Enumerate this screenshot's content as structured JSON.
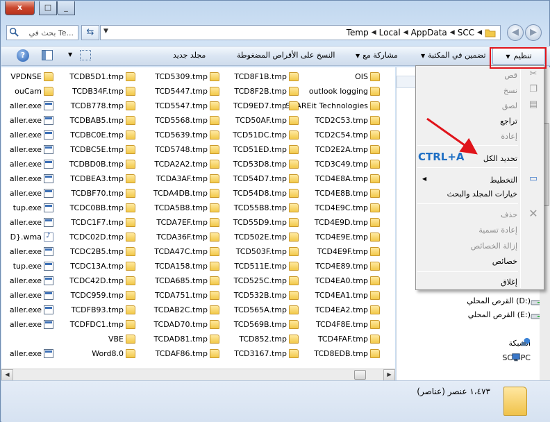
{
  "window": {
    "close_glyph": "x",
    "max_glyph": "□",
    "min_glyph": "_"
  },
  "address": {
    "search_placeholder": "بحث في Te...",
    "crumbs": [
      "SCC",
      "AppData",
      "Local",
      "Temp"
    ]
  },
  "toolbar": {
    "organize": "تنظيم",
    "include_library": "تضمين في المكتبة",
    "share_with": "مشاركة مع",
    "burn": "النسخ على الأقراص المضغوطة",
    "new_folder": "مجلد جديد"
  },
  "file_columns": [
    [
      {
        "name": "OIS",
        "icon": "folder"
      },
      {
        "name": "outlook logging",
        "icon": "folder"
      },
      {
        "name": "SHAREit Technologies",
        "icon": "folder"
      },
      {
        "name": "TCD2C53.tmp",
        "icon": "folder"
      },
      {
        "name": "TCD2C54.tmp",
        "icon": "folder"
      },
      {
        "name": "TCD2E2A.tmp",
        "icon": "folder"
      },
      {
        "name": "TCD3C49.tmp",
        "icon": "folder"
      },
      {
        "name": "TCD4E8A.tmp",
        "icon": "folder"
      },
      {
        "name": "TCD4E8B.tmp",
        "icon": "folder"
      },
      {
        "name": "TCD4E9C.tmp",
        "icon": "folder"
      },
      {
        "name": "TCD4E9D.tmp",
        "icon": "folder"
      },
      {
        "name": "TCD4E9E.tmp",
        "icon": "folder"
      },
      {
        "name": "TCD4E9F.tmp",
        "icon": "folder"
      },
      {
        "name": "TCD4E89.tmp",
        "icon": "folder"
      },
      {
        "name": "TCD4EA0.tmp",
        "icon": "folder"
      },
      {
        "name": "TCD4EA1.tmp",
        "icon": "folder"
      },
      {
        "name": "TCD4EA2.tmp",
        "icon": "folder"
      },
      {
        "name": "TCD4F8E.tmp",
        "icon": "folder"
      },
      {
        "name": "TCD4FAF.tmp",
        "icon": "folder"
      },
      {
        "name": "TCD8EDB.tmp",
        "icon": "folder"
      }
    ],
    [
      {
        "name": "TCD8F1B.tmp",
        "icon": "folder"
      },
      {
        "name": "TCD8F2B.tmp",
        "icon": "folder"
      },
      {
        "name": "TCD9ED7.tmp",
        "icon": "folder"
      },
      {
        "name": "TCD50AF.tmp",
        "icon": "folder"
      },
      {
        "name": "TCD51DC.tmp",
        "icon": "folder"
      },
      {
        "name": "TCD51ED.tmp",
        "icon": "folder"
      },
      {
        "name": "TCD53D8.tmp",
        "icon": "folder"
      },
      {
        "name": "TCD54D7.tmp",
        "icon": "folder"
      },
      {
        "name": "TCD54D8.tmp",
        "icon": "folder"
      },
      {
        "name": "TCD55B8.tmp",
        "icon": "folder"
      },
      {
        "name": "TCD55D9.tmp",
        "icon": "folder"
      },
      {
        "name": "TCD502E.tmp",
        "icon": "folder"
      },
      {
        "name": "TCD503F.tmp",
        "icon": "folder"
      },
      {
        "name": "TCD511E.tmp",
        "icon": "folder"
      },
      {
        "name": "TCD525C.tmp",
        "icon": "folder"
      },
      {
        "name": "TCD532B.tmp",
        "icon": "folder"
      },
      {
        "name": "TCD565A.tmp",
        "icon": "folder"
      },
      {
        "name": "TCD569B.tmp",
        "icon": "folder"
      },
      {
        "name": "TCD852.tmp",
        "icon": "folder"
      },
      {
        "name": "TCD3167.tmp",
        "icon": "folder"
      }
    ],
    [
      {
        "name": "TCD5309.tmp",
        "icon": "folder"
      },
      {
        "name": "TCD5447.tmp",
        "icon": "folder"
      },
      {
        "name": "TCD5547.tmp",
        "icon": "folder"
      },
      {
        "name": "TCD5568.tmp",
        "icon": "folder"
      },
      {
        "name": "TCD5639.tmp",
        "icon": "folder"
      },
      {
        "name": "TCD5748.tmp",
        "icon": "folder"
      },
      {
        "name": "TCDA2A2.tmp",
        "icon": "folder"
      },
      {
        "name": "TCDA3AF.tmp",
        "icon": "folder"
      },
      {
        "name": "TCDA4DB.tmp",
        "icon": "folder"
      },
      {
        "name": "TCDA5B8.tmp",
        "icon": "folder"
      },
      {
        "name": "TCDA7EF.tmp",
        "icon": "folder"
      },
      {
        "name": "TCDA36F.tmp",
        "icon": "folder"
      },
      {
        "name": "TCDA47C.tmp",
        "icon": "folder"
      },
      {
        "name": "TCDA158.tmp",
        "icon": "folder"
      },
      {
        "name": "TCDA685.tmp",
        "icon": "folder"
      },
      {
        "name": "TCDA751.tmp",
        "icon": "folder"
      },
      {
        "name": "TCDAB2C.tmp",
        "icon": "folder"
      },
      {
        "name": "TCDAD70.tmp",
        "icon": "folder"
      },
      {
        "name": "TCDAD81.tmp",
        "icon": "folder"
      },
      {
        "name": "TCDAF86.tmp",
        "icon": "folder"
      }
    ],
    [
      {
        "name": "TCDB5D1.tmp",
        "icon": "folder"
      },
      {
        "name": "TCDB34F.tmp",
        "icon": "folder"
      },
      {
        "name": "TCDB778.tmp",
        "icon": "folder"
      },
      {
        "name": "TCDBAB5.tmp",
        "icon": "folder"
      },
      {
        "name": "TCDBC0E.tmp",
        "icon": "folder"
      },
      {
        "name": "TCDBC5E.tmp",
        "icon": "folder"
      },
      {
        "name": "TCDBD0B.tmp",
        "icon": "folder"
      },
      {
        "name": "TCDBEA3.tmp",
        "icon": "folder"
      },
      {
        "name": "TCDBF70.tmp",
        "icon": "folder"
      },
      {
        "name": "TCDC0BB.tmp",
        "icon": "folder"
      },
      {
        "name": "TCDC1F7.tmp",
        "icon": "folder"
      },
      {
        "name": "TCDC02D.tmp",
        "icon": "folder"
      },
      {
        "name": "TCDC2B5.tmp",
        "icon": "folder"
      },
      {
        "name": "TCDC13A.tmp",
        "icon": "folder"
      },
      {
        "name": "TCDC42D.tmp",
        "icon": "folder"
      },
      {
        "name": "TCDC959.tmp",
        "icon": "folder"
      },
      {
        "name": "TCDFB93.tmp",
        "icon": "folder"
      },
      {
        "name": "TCDFDC1.tmp",
        "icon": "folder"
      },
      {
        "name": "VBE",
        "icon": "folder"
      },
      {
        "name": "Word8.0",
        "icon": "folder"
      }
    ],
    [
      {
        "name": "VPDNSE",
        "icon": "folder"
      },
      {
        "name": "ouCam",
        "icon": "folder"
      },
      {
        "name": "aller.exe",
        "icon": "exe"
      },
      {
        "name": "aller.exe",
        "icon": "exe"
      },
      {
        "name": "aller.exe",
        "icon": "exe"
      },
      {
        "name": "aller.exe",
        "icon": "exe"
      },
      {
        "name": "aller.exe",
        "icon": "exe"
      },
      {
        "name": "aller.exe",
        "icon": "exe"
      },
      {
        "name": "aller.exe",
        "icon": "exe"
      },
      {
        "name": "tup.exe",
        "icon": "exe"
      },
      {
        "name": "aller.exe",
        "icon": "exe"
      },
      {
        "name": "D}.wma",
        "icon": "wma"
      },
      {
        "name": "aller.exe",
        "icon": "exe"
      },
      {
        "name": "tup.exe",
        "icon": "exe"
      },
      {
        "name": "aller.exe",
        "icon": "exe"
      },
      {
        "name": "aller.exe",
        "icon": "exe"
      },
      {
        "name": "aller.exe",
        "icon": "exe"
      },
      {
        "name": "aller.exe",
        "icon": "exe"
      },
      {
        "name": "",
        "icon": "none"
      },
      {
        "name": "aller.exe",
        "icon": "exe"
      }
    ]
  ],
  "nav_pane": {
    "drive_d": "القرص المحلي (D:)",
    "drive_e": "القرص المحلي (E:)",
    "network": "الشبكة",
    "computer": "SCC-PC"
  },
  "status": {
    "count": "١،٤٧٣ عنصر (عناصر)"
  },
  "menu": {
    "cut": "قص",
    "copy": "نسخ",
    "paste": "لصق",
    "undo": "تراجع",
    "redo": "إعادة",
    "select_all": "تحديد الكل",
    "layout": "التخطيط",
    "folder_options": "خيارات المجلد والبحث",
    "delete": "حذف",
    "rename": "إعادة تسمية",
    "remove_props": "إزالة الخصائص",
    "properties": "خصائص",
    "close": "إغلاق"
  },
  "annotation": {
    "hint": "CTRL+A",
    "color": "#e0141b"
  }
}
